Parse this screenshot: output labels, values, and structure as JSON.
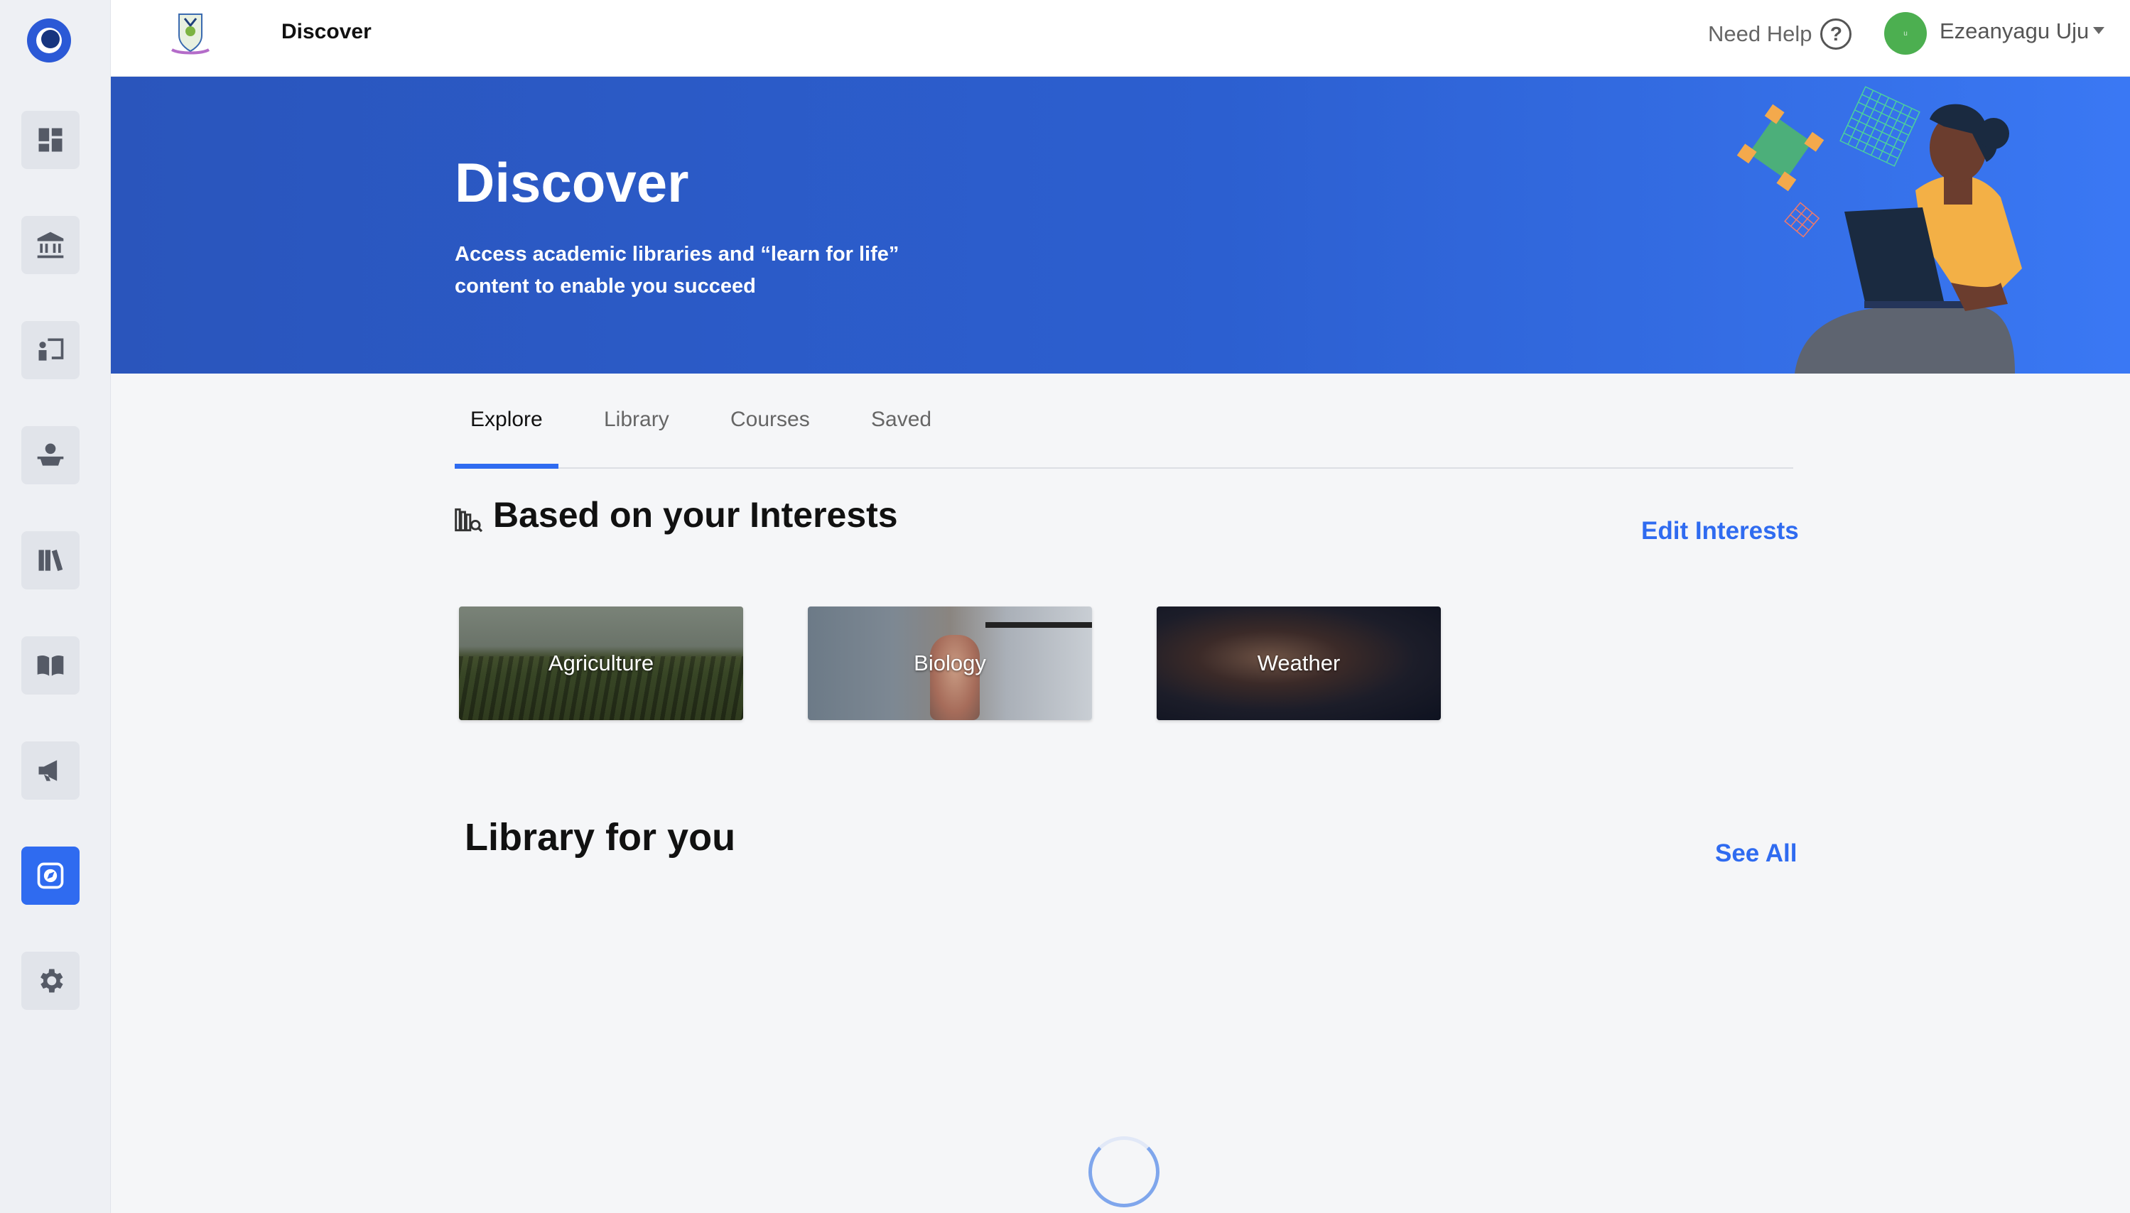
{
  "app": {
    "title": "Discover"
  },
  "header": {
    "title": "Discover",
    "help_label": "Need Help",
    "help_icon": "question-circle-icon",
    "user": {
      "name": "Ezeanyagu Uju",
      "avatar_initial": "u",
      "avatar_color": "#4caf50"
    }
  },
  "sidebar": {
    "items": [
      {
        "name": "dashboard",
        "icon": "dashboard-icon"
      },
      {
        "name": "institution",
        "icon": "bank-icon"
      },
      {
        "name": "classroom",
        "icon": "teacher-board-icon"
      },
      {
        "name": "students",
        "icon": "student-icon"
      },
      {
        "name": "library",
        "icon": "books-icon"
      },
      {
        "name": "reading",
        "icon": "open-book-icon"
      },
      {
        "name": "announcements",
        "icon": "megaphone-icon"
      },
      {
        "name": "discover",
        "icon": "compass-icon",
        "active": true
      },
      {
        "name": "settings",
        "icon": "gear-icon"
      }
    ],
    "accent": "#2f6bf0"
  },
  "banner": {
    "title": "Discover",
    "subtitle": "Access academic libraries and “learn for life” content to enable you succeed",
    "background": "#2c5fd0"
  },
  "tabs": [
    {
      "label": "Explore",
      "active": true
    },
    {
      "label": "Library",
      "active": false
    },
    {
      "label": "Courses",
      "active": false
    },
    {
      "label": "Saved",
      "active": false
    }
  ],
  "interests": {
    "title": "Based on your Interests",
    "action_label": "Edit Interests",
    "cards": [
      {
        "label": "Agriculture"
      },
      {
        "label": "Biology"
      },
      {
        "label": "Weather"
      }
    ]
  },
  "library": {
    "title": "Library for you",
    "action_label": "See All"
  },
  "colors": {
    "accent": "#2f6bf0",
    "page_bg": "#f5f6f8"
  }
}
